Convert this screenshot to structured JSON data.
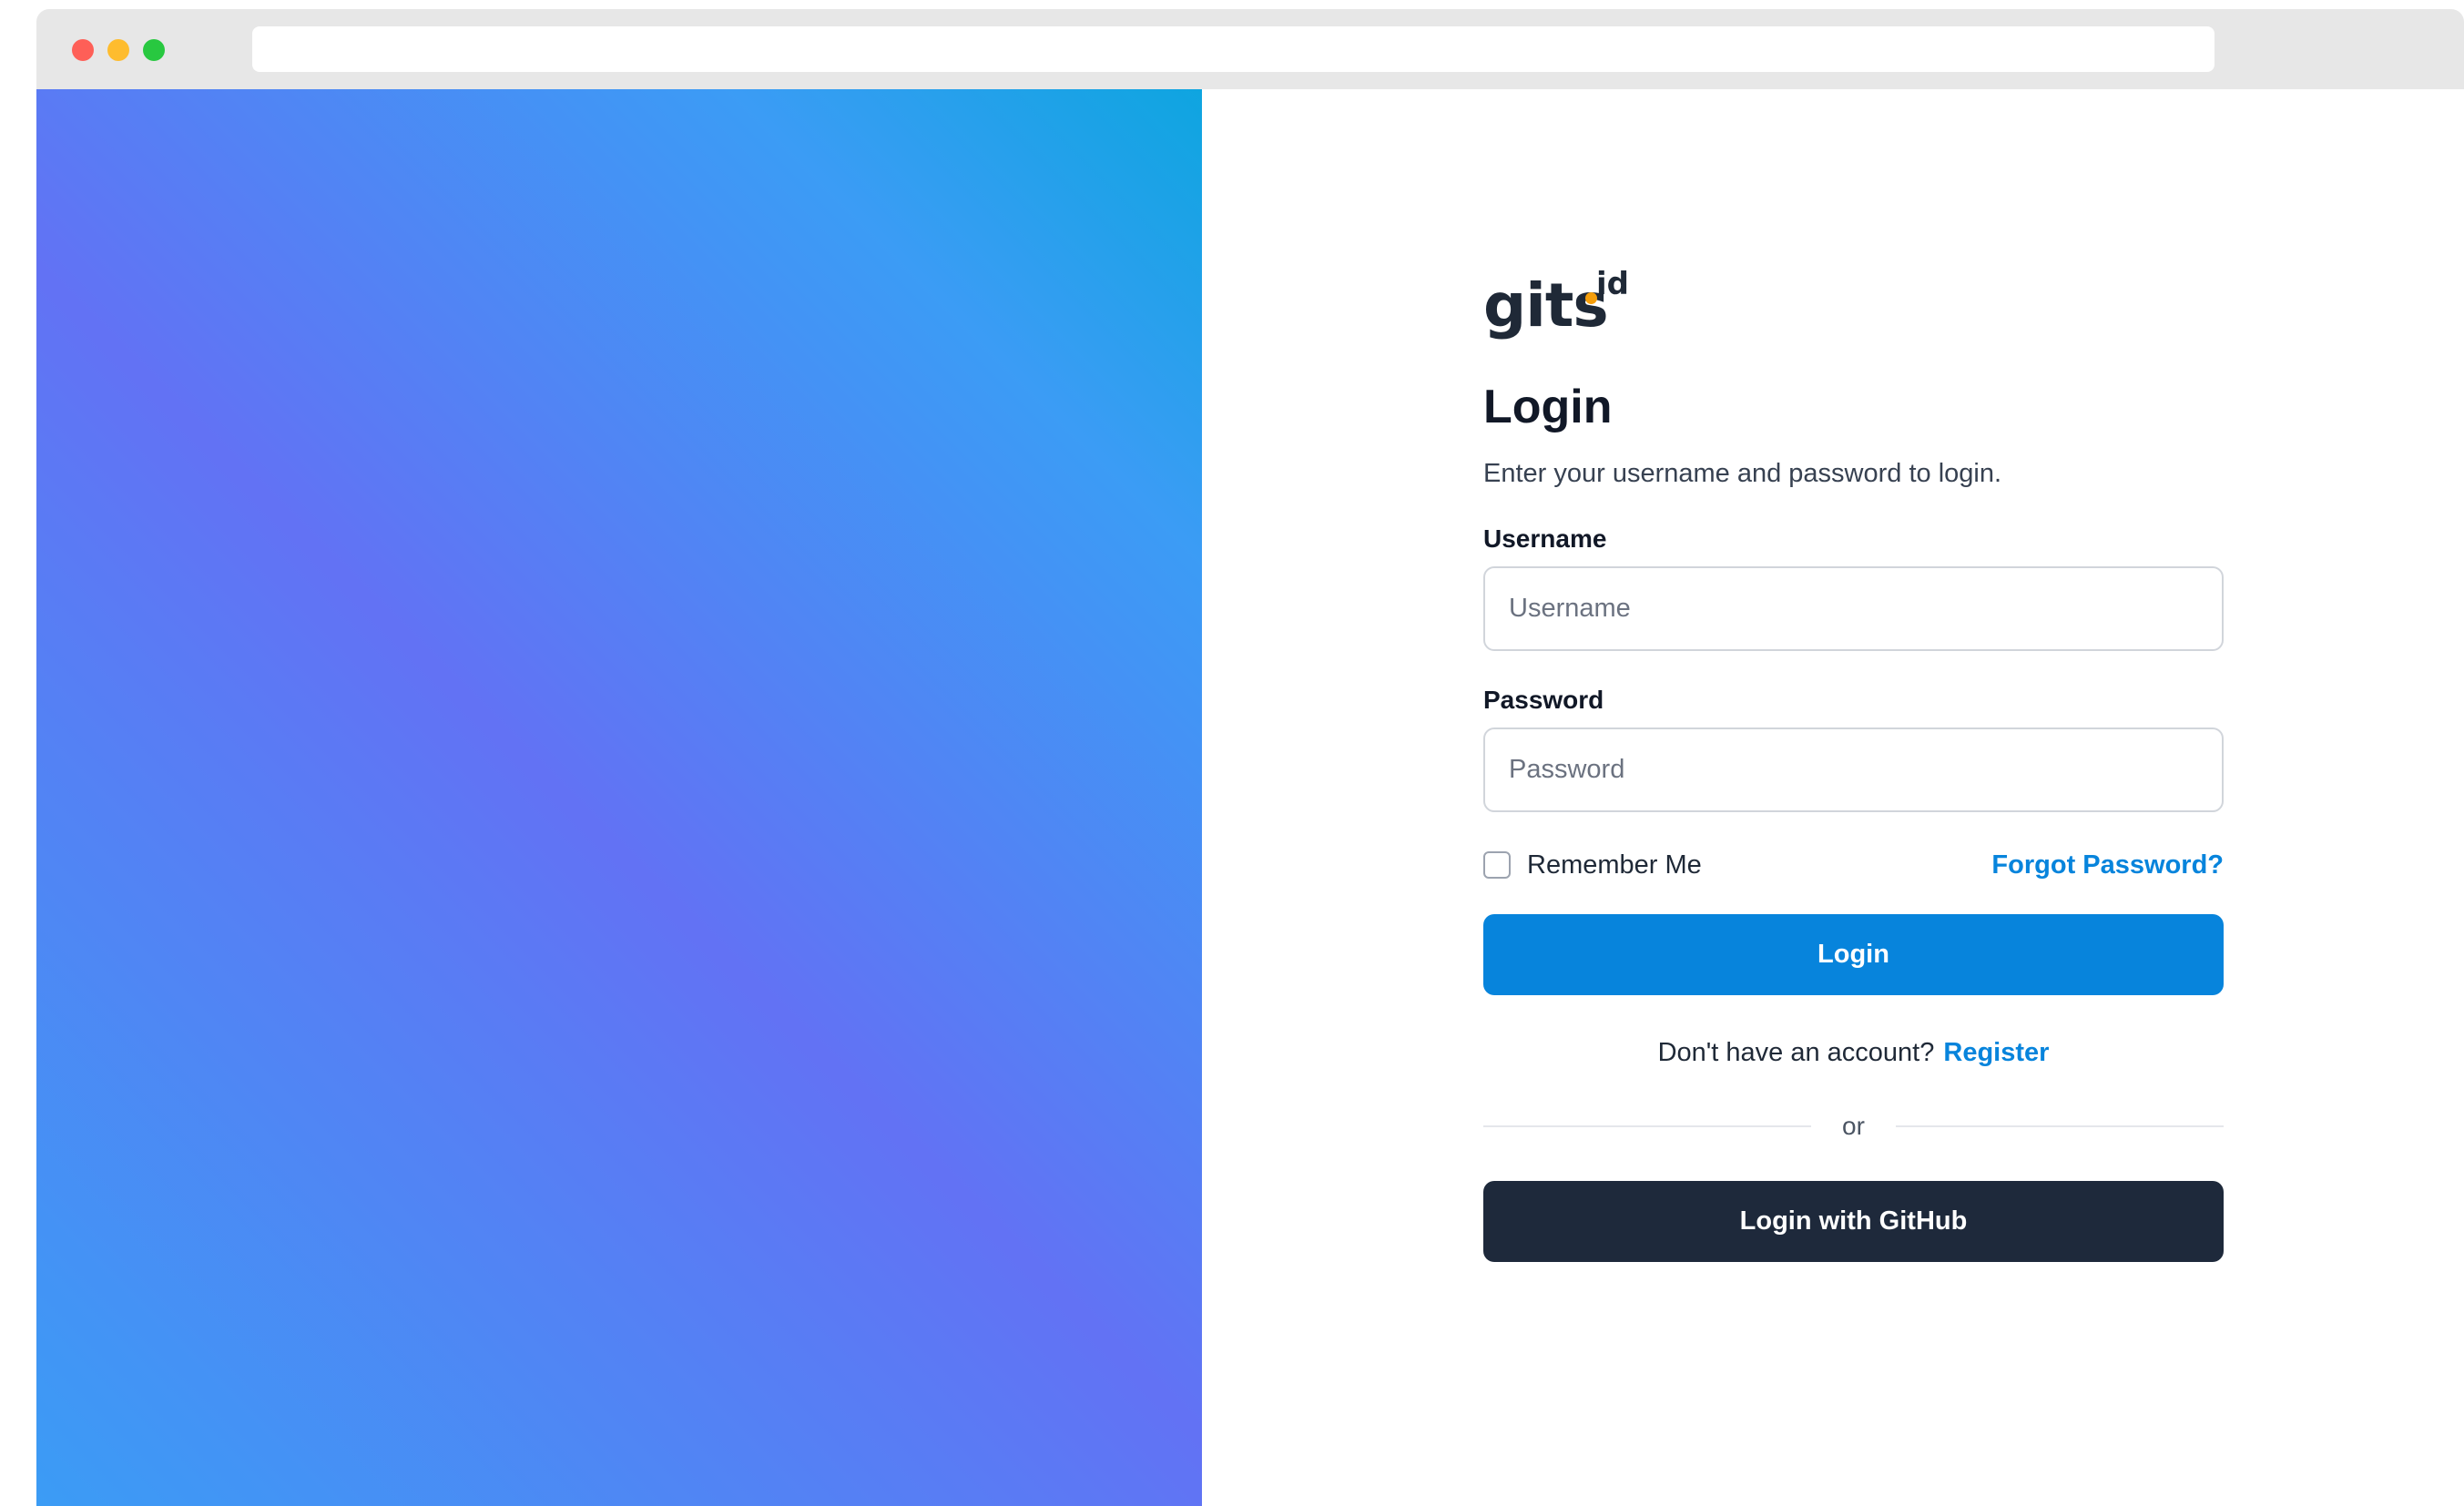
{
  "colors": {
    "chrome_bg": "#e7e7e7",
    "traffic_red": "#fe5f57",
    "traffic_yellow": "#febc2e",
    "traffic_green": "#28c840",
    "gradient": [
      "#3b9cf5",
      "#6272f4",
      "#0ea5e0"
    ],
    "primary": "#0784dc",
    "link": "#0784dc",
    "dark_button": "#1e293b",
    "logo_dark": "#1f2937",
    "logo_dot": "#0ea5e9",
    "logo_id_dot": "#f59e0b",
    "divider": "#e5e7eb"
  },
  "browser": {
    "address": ""
  },
  "logo": {
    "wordmark": "gits",
    "suffix": "id",
    "icon": "gits-id-logo"
  },
  "login": {
    "title": "Login",
    "subtitle": "Enter your username and password to login.",
    "username_label": "Username",
    "username_placeholder": "Username",
    "username_value": "",
    "password_label": "Password",
    "password_placeholder": "Password",
    "password_value": "",
    "remember_label": "Remember Me",
    "remember_checked": false,
    "forgot_label": "Forgot Password?",
    "submit_label": "Login",
    "register_prompt": "Don't have an account?",
    "register_label": "Register",
    "divider_text": "or",
    "github_label": "Login with GitHub"
  }
}
